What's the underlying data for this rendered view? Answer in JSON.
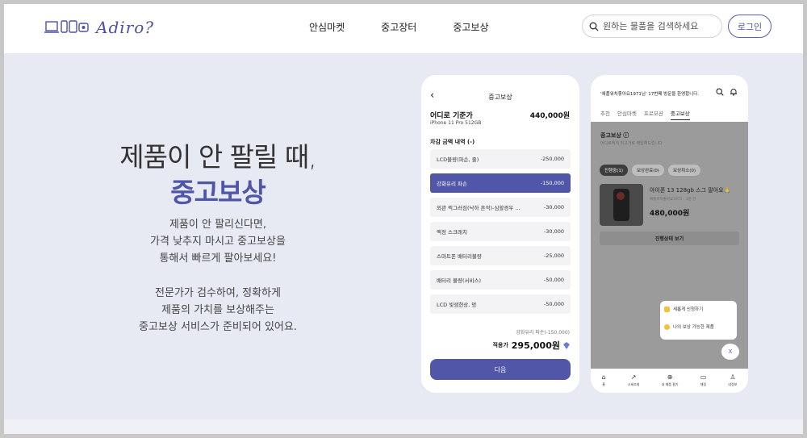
{
  "header": {
    "logo_text": "Adiro?",
    "nav": [
      "안심마켓",
      "중고장터",
      "중고보상"
    ],
    "search_placeholder": "원하는 물품을 검색하세요",
    "login_label": "로그인"
  },
  "hero": {
    "title_line1": "제품이 안 팔릴 때,",
    "title_line2": "중고보상",
    "desc1": [
      "제품이 안 팔리신다면,",
      "가격 낮추지 마시고 중고보상을",
      "통해서 빠르게 팔아보세요!"
    ],
    "desc2": [
      "전문가가 검수하여, 정확하게",
      "제품의 가치를 보상해주는",
      "중고보상 서비스가 준비되어 있어요."
    ]
  },
  "phone1": {
    "title": "중고보상",
    "back_icon": "chevron-left-icon",
    "product_name": "어디로 기준가",
    "product_model": "iPhone 11 Pro 512GB",
    "base_price": "440,000원",
    "section_label": "차감 금액 내역 (-)",
    "deductions": [
      {
        "label": "LCD불량(파손, 줄)",
        "amount": "-250,000",
        "selected": false
      },
      {
        "label": "강화유리 파손",
        "amount": "-150,000",
        "selected": true
      },
      {
        "label": "외관 찍그러짐(낙하 흔적)-심할경우 ...",
        "amount": "-30,000",
        "selected": false
      },
      {
        "label": "액정 스크래치",
        "amount": "-30,000",
        "selected": false
      },
      {
        "label": "스마트폰 배터리불량",
        "amount": "-25,000",
        "selected": false
      },
      {
        "label": "배터리 불량(서비스)",
        "amount": "-50,000",
        "selected": false
      },
      {
        "label": "LCD 빛샘현상, 멍",
        "amount": "-50,000",
        "selected": false
      }
    ],
    "applied_note": "강화유리 파손(-150,000)",
    "total_label": "적용가",
    "total_value": "295,000원",
    "next_label": "다음"
  },
  "phone2": {
    "welcome": "'애플워치좋아요1971님' 17번째 방문을 환영합니다.",
    "tabs": [
      "추천",
      "안심마켓",
      "프로모션",
      "중고보상"
    ],
    "active_tab": "중고보상",
    "section_title": "중고보상 ⓘ",
    "section_sub": "어디로에게 최고가로 매입해드립니다.",
    "chips": [
      "진행중(1)",
      "보상완료(0)",
      "보상취소(0)"
    ],
    "item_name": "아이폰 13 128gb 스그 팔아요🙏",
    "item_sub": "애플워치좋아요1971 · 1분 전",
    "item_price": "480,000원",
    "status_button": "진행상태 보기",
    "popup_items": [
      "새롭게 신청하기",
      "나의 보상 가능한 제품"
    ],
    "close_label": "X",
    "tabbar": [
      {
        "icon": "home-icon",
        "label": "홈"
      },
      {
        "icon": "chart-icon",
        "label": "시세조회"
      },
      {
        "icon": "plus-circle-icon",
        "label": "내 제품 팔기"
      },
      {
        "icon": "chat-icon",
        "label": "채팅"
      },
      {
        "icon": "user-icon",
        "label": "내정보"
      }
    ]
  },
  "colors": {
    "accent": "#5256a8",
    "background": "#e8eaf3"
  }
}
